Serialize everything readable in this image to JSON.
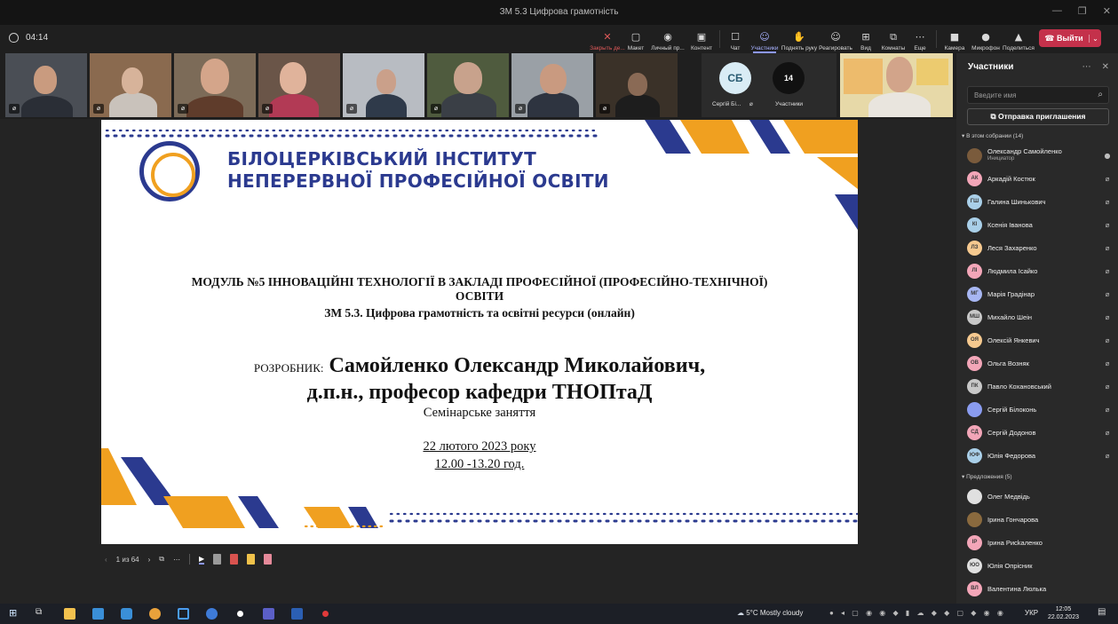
{
  "window": {
    "title": "ЗМ 5.3 Цифрова грамотність"
  },
  "toolbar": {
    "timer": "04:14",
    "buttons": [
      {
        "label": "Закрыть де...",
        "icon": "✕"
      },
      {
        "label": "Макет",
        "icon": "▢"
      },
      {
        "label": "Личный пр...",
        "icon": "◉"
      },
      {
        "label": "Контент",
        "icon": "▣"
      },
      {
        "label": "Чат",
        "icon": "☐"
      },
      {
        "label": "Участники",
        "icon": "☺"
      },
      {
        "label": "Поднять руку",
        "icon": "✋"
      },
      {
        "label": "Реагировать",
        "icon": "☺"
      },
      {
        "label": "Вид",
        "icon": "⊞"
      },
      {
        "label": "Комнаты",
        "icon": "⧉"
      },
      {
        "label": "Еще",
        "icon": "⋯"
      },
      {
        "label": "Камера",
        "icon": "■"
      },
      {
        "label": "Микрофон",
        "icon": "●"
      },
      {
        "label": "Поделиться",
        "icon": "▲"
      }
    ],
    "leave_label": "Выйти"
  },
  "gallery": {
    "avatar_initials": "СБ",
    "avatar_name": "Сергій Бі...",
    "overflow_count": "14",
    "overflow_label": "Участники"
  },
  "slide": {
    "institute_line1": "БІЛОЦЕРКІВСЬКИЙ ІНСТИТУТ",
    "institute_line2": "НЕПЕРЕРВНОЇ ПРОФЕСІЙНОЇ ОСВІТИ",
    "module_line1": "МОДУЛЬ №5 ІННОВАЦІЙНІ ТЕХНОЛОГІЇ В ЗАКЛАДІ ПРОФЕСІЙНОЇ (ПРОФЕСІЙНО-ТЕХНІЧНОЇ)",
    "module_line2": "ОСВІТИ",
    "module_line3": "ЗМ 5.3. Цифрова грамотність та освітні ресурси (онлайн)",
    "developer_prefix": "РОЗРОБНИК:",
    "developer_name": "Самойленко Олександр Миколайович,",
    "developer_title": "д.п.н., професор кафедри ТНОПтаД",
    "session_type": "Семінарське заняття",
    "date": "22 лютого 2023  року",
    "time": "12.00 -13.20 год."
  },
  "slide_controls": {
    "page": "1 из 64"
  },
  "panel": {
    "title": "Участники",
    "search_placeholder": "Введите имя",
    "invite_label": "Отправка приглашения",
    "in_meeting_header": "В этом собрании (14)",
    "suggestions_header": "Предложения (5)",
    "organizer_label": "Инициатор",
    "in_meeting": [
      {
        "initials": "",
        "name": "Олександр Самойленко",
        "color": "#7a5b3c",
        "photo": true,
        "mic": "on"
      },
      {
        "initials": "АК",
        "name": "Аркадій Костюк",
        "color": "#f3a6b8",
        "mic": "off"
      },
      {
        "initials": "ГШ",
        "name": "Галина Шинькович",
        "color": "#a9cfe8",
        "mic": "off"
      },
      {
        "initials": "КІ",
        "name": "Ксенія Іванова",
        "color": "#a9cfe8",
        "mic": "off"
      },
      {
        "initials": "ЛЗ",
        "name": "Леся Захаренко",
        "color": "#f6c98f",
        "mic": "off"
      },
      {
        "initials": "ЛІ",
        "name": "Людмила Ісайко",
        "color": "#f3a6b8",
        "mic": "off"
      },
      {
        "initials": "МГ",
        "name": "Марія Градінар",
        "color": "#a7b6f2",
        "mic": "off"
      },
      {
        "initials": "МШ",
        "name": "Михайло Шеін",
        "color": "#c8c8c8",
        "mic": "off"
      },
      {
        "initials": "ОЯ",
        "name": "Олексій Янкевич",
        "color": "#f6c98f",
        "mic": "off"
      },
      {
        "initials": "ОВ",
        "name": "Ольга Возняк",
        "color": "#f3a6b8",
        "mic": "off"
      },
      {
        "initials": "ПК",
        "name": "Павло Кохановський",
        "color": "#c8c8c8",
        "mic": "off"
      },
      {
        "initials": "",
        "name": "Сергій Білоконь",
        "color": "#8a9cf0",
        "photo": true,
        "mic": "off"
      },
      {
        "initials": "СД",
        "name": "Сергій Додонов",
        "color": "#f3a6b8",
        "mic": "off"
      },
      {
        "initials": "ЮФ",
        "name": "Юлія Федорова",
        "color": "#a9cfe8",
        "mic": "off"
      }
    ],
    "suggestions": [
      {
        "initials": "",
        "name": "Олег Медвідь",
        "color": "#e0e0e0",
        "photo": true
      },
      {
        "initials": "",
        "name": "Ірина Гончарова",
        "color": "#8a6a3e",
        "photo": true
      },
      {
        "initials": "ІР",
        "name": "Ірина Рисkаленко",
        "color": "#f3a6b8"
      },
      {
        "initials": "ЮО",
        "name": "Юлія Опрісник",
        "color": "#e0e0e0"
      },
      {
        "initials": "ВЛ",
        "name": "Валентина Люлька",
        "color": "#f3a6b8"
      }
    ]
  },
  "taskbar": {
    "weather": "5°C  Mostly cloudy",
    "language": "УКР",
    "time": "12:05",
    "date": "22.02.2023"
  }
}
